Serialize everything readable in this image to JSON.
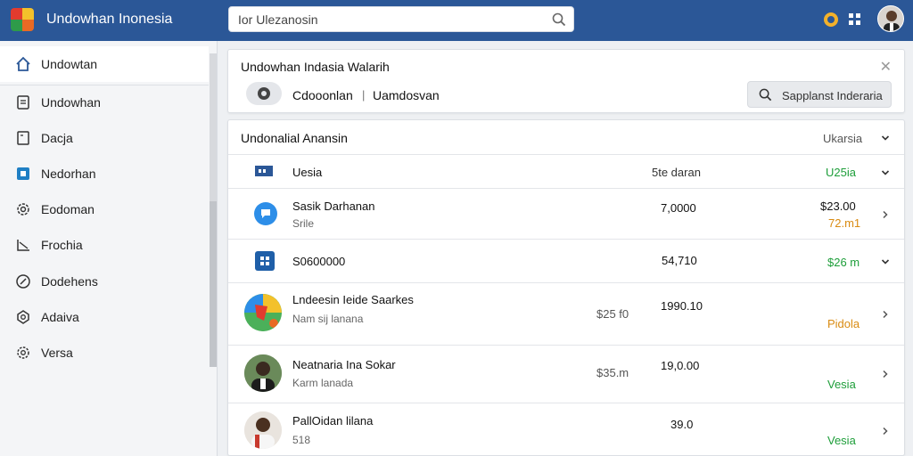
{
  "app": {
    "title": "Undowhan Inonesia"
  },
  "search": {
    "value": "Ior Ulezanosin"
  },
  "colors": {
    "header": "#2b5797",
    "green": "#1e9e3a",
    "orange": "#d98b12"
  },
  "sidebar": {
    "items": [
      {
        "label": "Undowtan",
        "icon": "home-icon"
      },
      {
        "label": "Undowhan",
        "icon": "document-icon"
      },
      {
        "label": "Dacja",
        "icon": "file-icon"
      },
      {
        "label": "Nedorhan",
        "icon": "square-icon"
      },
      {
        "label": "Eodoman",
        "icon": "gear-icon"
      },
      {
        "label": "Frochia",
        "icon": "chart-icon"
      },
      {
        "label": "Dodehens",
        "icon": "compass-icon"
      },
      {
        "label": "Adaiva",
        "icon": "gear-icon"
      },
      {
        "label": "Versa",
        "icon": "settings-icon"
      }
    ]
  },
  "card1": {
    "title": "Undowhan Indasia Walarih",
    "tab1": "Cdooonlan",
    "separator": "|",
    "tab2": "Uamdosvan",
    "search_label": "Sapplanst Inderaria"
  },
  "card2": {
    "title": "Undonalial Anansin",
    "filter": "Ukarsia",
    "header_row": {
      "name": "Uesia",
      "mid": "5te daran",
      "right": "U25ia"
    },
    "rows": [
      {
        "name": "Sasik Darhanan",
        "sub": "Srile",
        "mid": "7,0000",
        "right1": "$23.00",
        "right2": "72.m1"
      },
      {
        "name": "S0600000",
        "mid": "54,710",
        "right1": "$26 m"
      },
      {
        "name": "Lndeesin Ieide Saarkes",
        "sub": "Nam sij lanana",
        "pre": "$25 f0",
        "mid": "1990.10",
        "right1": "Pidola"
      },
      {
        "name": "Neatnaria Ina Sokar",
        "sub": "Karm lanada",
        "pre": "$35.m",
        "mid": "19,0.00",
        "right1": "Vesia"
      },
      {
        "name": "PallOidan lilana",
        "sub": "518",
        "mid": "39.0",
        "right1": "Vesia"
      }
    ]
  }
}
